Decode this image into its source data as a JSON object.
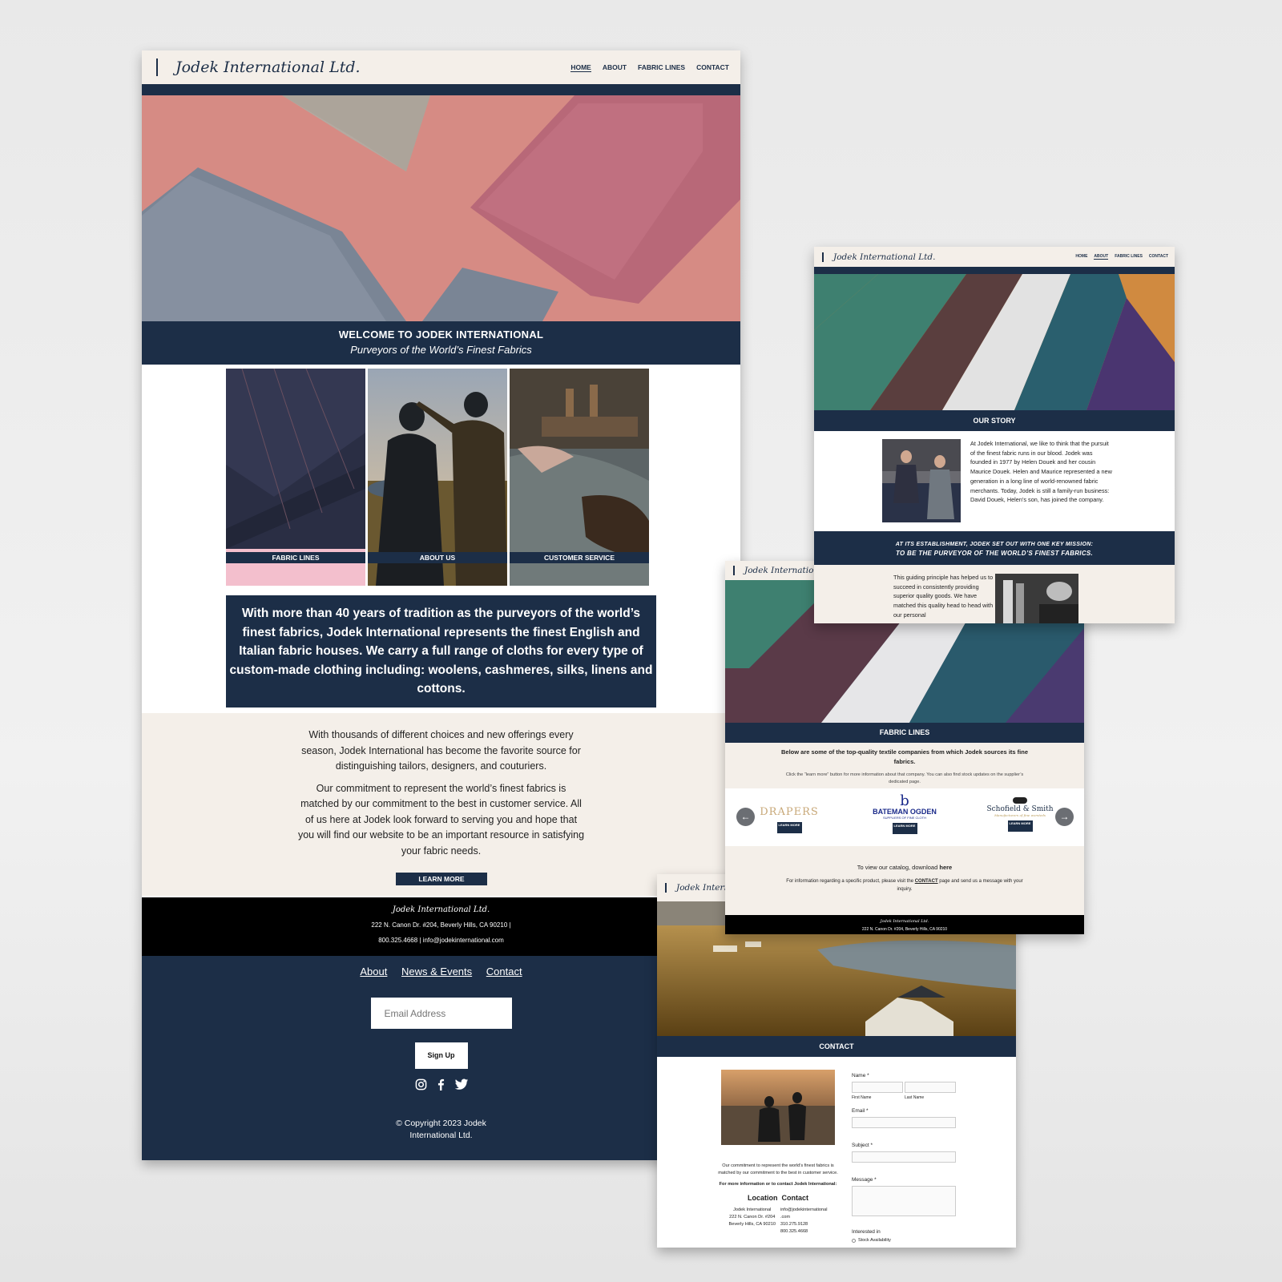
{
  "brand": {
    "logo_text": "Jodek International Ltd.",
    "navy": "#1c2e47",
    "cream": "#f4efe9"
  },
  "main": {
    "nav": [
      "HOME",
      "ABOUT",
      "FABRIC LINES",
      "CONTACT"
    ],
    "welcome_title": "WELCOME TO JODEK INTERNATIONAL",
    "welcome_subtitle": "Purveyors of the World’s Finest Fabrics",
    "tiles": [
      "FABRIC LINES",
      "ABOUT US",
      "CUSTOMER SERVICE"
    ],
    "quote": "With more than 40 years of tradition as the purveyors of the world’s finest fabrics,  Jodek International represents the finest English and Italian fabric houses.  We carry a full range of cloths for every type of custom-made clothing including: woolens, cashmeres, silks, linens and cottons.",
    "para1": "With thousands of different choices and new offerings every season, Jodek International has become the favorite source for distinguishing tailors, designers, and couturiers.",
    "para2": "Our commitment to represent the world’s finest fabrics is matched by our commitment to the best in customer service. All of us here at Jodek look forward to serving you and hope that you will find our website to be an important resource in satisfying your fabric needs.",
    "learn_more": "LEARN MORE",
    "footer_address": "222 N. Canon Dr. #204, Beverly Hills, CA 90210  |",
    "footer_contact": "800.325.4668  |  info@jodekinternational.com",
    "footer_links": [
      "About",
      "News & Events",
      "Contact"
    ],
    "email_placeholder": "Email Address",
    "signup": "Sign Up",
    "social_icons": [
      "instagram-icon",
      "facebook-icon",
      "twitter-icon"
    ],
    "copyright_line1": "© Copyright 2023 Jodek",
    "copyright_line2": "International Ltd."
  },
  "about": {
    "nav": [
      "HOME",
      "ABOUT",
      "FABRIC LINES",
      "CONTACT"
    ],
    "title": "OUR STORY",
    "story": "At Jodek International, we like to think that the pursuit of the finest fabric runs in our blood. Jodek was founded in 1977 by Helen Douek and her cousin Maurice Douek.  Helen and Maurice represented a new generation in a long line of world-renowned fabric merchants. Today, Jodek is still a family-run business: David Douek, Helen’s son, has joined the company.",
    "mission_line1": "AT ITS ESTABLISHMENT, JODEK SET OUT WITH ONE KEY MISSION:",
    "mission_line2": "TO BE THE PURVEYOR OF THE WORLD’S FINEST FABRICS.",
    "principle": "This guiding principle has helped us to succeed in consistently providing superior quality goods. We have matched this quality head to head with our personal"
  },
  "fabric": {
    "title": "FABRIC LINES",
    "intro_bold": "Below are some of the top-quality textile companies from which Jodek sources its fine fabrics.",
    "intro_small": "Click the “learn more” button for more information about that company. You can also find stock updates on the supplier’s dedicated page.",
    "brands": [
      {
        "name": "DRAPERS",
        "sub": ""
      },
      {
        "name": "BATEMAN OGDEN",
        "sub": "SUPPLIERS OF FINE CLOTH"
      },
      {
        "name": "Schofield & Smith",
        "sub": "Manufacturers of fine worsteds"
      }
    ],
    "learn_more": "LEARN MORE",
    "catalog_prefix": "To view our catalog, download ",
    "catalog_link": "here",
    "info_prefix": "For information regarding a specific product, please visit the ",
    "info_link": "CONTACT",
    "info_suffix": " page and send us a message with your inquiry.",
    "footer_address": "222 N. Canon Dr. #204, Beverly Hills, CA 90210"
  },
  "contact": {
    "title": "CONTACT",
    "commitment": "Our commitment to represent the world’s finest fabrics is matched by our commitment to the best in customer service.",
    "more_info": "For more information or to contact Jodek International:",
    "location_heading": "Location",
    "contact_heading": "Contact",
    "location_lines": [
      "Jodek International",
      "222 N. Canon Dr. #204",
      "Beverly Hills, CA 90210"
    ],
    "contact_lines": [
      "info@jodekinternational",
      ".com",
      "310.275.9128",
      "800.325.4668"
    ],
    "form": {
      "name_label": "Name *",
      "first_name": "First Name",
      "last_name": "Last Name",
      "email_label": "Email *",
      "subject_label": "Subject *",
      "message_label": "Message *",
      "interested_label": "Interested in",
      "option1": "Stock Availability"
    }
  }
}
